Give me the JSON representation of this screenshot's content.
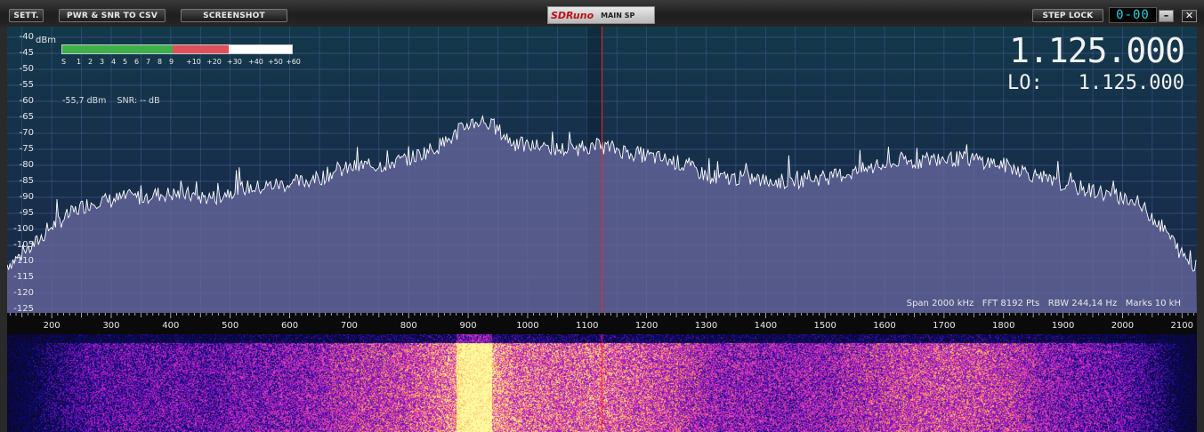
{
  "toolbar": {
    "sett_label": "SETT.",
    "csv_label": "PWR & SNR TO CSV",
    "screenshot_label": "SCREENSHOT",
    "step_lock_label": "STEP LOCK",
    "brand": "SDRuno",
    "window_name": "MAIN SP",
    "counter": "0-00",
    "minimize_icon": "minimize-icon",
    "close_icon": "close-icon"
  },
  "spectrum": {
    "unit": "dBm",
    "y_labels": [
      "-40",
      "-45",
      "-50",
      "-55",
      "-60",
      "-65",
      "-70",
      "-75",
      "-80",
      "-85",
      "-90",
      "-95",
      "-100",
      "-105",
      "-110",
      "-115",
      "-120",
      "-125"
    ],
    "x_labels": [
      "200",
      "300",
      "400",
      "500",
      "600",
      "700",
      "800",
      "900",
      "1000",
      "1100",
      "1200",
      "1300",
      "1400",
      "1500",
      "1600",
      "1700",
      "1800",
      "1900",
      "2000",
      "2100"
    ],
    "smeter_scale": [
      "S",
      "1",
      "2",
      "3",
      "4",
      "5",
      "6",
      "7",
      "8",
      "9",
      "+10",
      "+20",
      "+30",
      "+40",
      "+50",
      "+60"
    ],
    "power_readout": "-55,7 dBm",
    "snr_readout": "SNR: -- dB",
    "frequency": "1.125.000",
    "lo_label": "LO:",
    "lo_frequency": "1.125.000",
    "status": "Span 2000 kHz   FFT 8192 Pts   RBW 244,14 Hz   Marks 10 kH",
    "colors": {
      "trace": "#ffffff",
      "fill": "#6a6aa0",
      "marker": "#ff2020",
      "bg_top": "#13384a"
    }
  },
  "chart_data": {
    "type": "area",
    "xlabel": "",
    "ylabel": "dBm",
    "xlim": [
      125,
      2125
    ],
    "ylim": [
      -127,
      -38
    ],
    "tuned_kHz": 1125,
    "x": [
      125,
      150,
      175,
      200,
      225,
      250,
      275,
      300,
      325,
      350,
      375,
      400,
      425,
      450,
      475,
      500,
      525,
      550,
      575,
      600,
      625,
      650,
      675,
      700,
      725,
      750,
      775,
      800,
      825,
      850,
      875,
      900,
      925,
      950,
      975,
      1000,
      1025,
      1050,
      1075,
      1100,
      1125,
      1150,
      1175,
      1200,
      1225,
      1250,
      1275,
      1300,
      1325,
      1350,
      1375,
      1400,
      1425,
      1450,
      1475,
      1500,
      1525,
      1550,
      1575,
      1600,
      1625,
      1650,
      1675,
      1700,
      1725,
      1750,
      1775,
      1800,
      1825,
      1850,
      1875,
      1900,
      1925,
      1950,
      1975,
      2000,
      2025,
      2050,
      2075,
      2100,
      2125
    ],
    "values": [
      -111,
      -108,
      -104,
      -99,
      -96,
      -93,
      -91,
      -91,
      -90,
      -90,
      -89,
      -89,
      -89,
      -90,
      -90,
      -88,
      -87,
      -87,
      -86,
      -86,
      -85,
      -84,
      -82,
      -81,
      -80,
      -80,
      -79,
      -78,
      -76,
      -74,
      -71,
      -67,
      -66,
      -69,
      -73,
      -74,
      -74,
      -75,
      -75,
      -74,
      -74,
      -75,
      -76,
      -77,
      -78,
      -79,
      -81,
      -83,
      -84,
      -84,
      -84,
      -85,
      -85,
      -85,
      -84,
      -84,
      -83,
      -82,
      -81,
      -80,
      -79,
      -79,
      -78,
      -78,
      -78,
      -78,
      -79,
      -80,
      -81,
      -83,
      -85,
      -86,
      -87,
      -88,
      -89,
      -90,
      -92,
      -96,
      -101,
      -108,
      -112
    ]
  }
}
